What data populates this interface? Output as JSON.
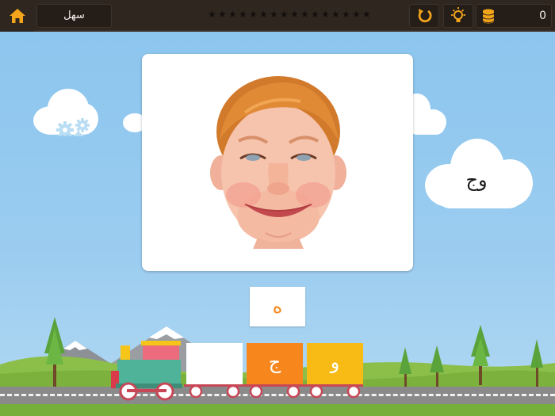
{
  "topbar": {
    "level_label": "سهل",
    "star_count": 16,
    "coins": "0",
    "icons": {
      "home": "home-icon",
      "reset": "reset-icon",
      "hint": "lightbulb-icon",
      "coins": "coin-stack-icon"
    },
    "colors": {
      "bar": "#2f2620",
      "accent": "#f2a51b"
    }
  },
  "clouds": {
    "word": "وج"
  },
  "answer": {
    "letter": "ه"
  },
  "train": {
    "wagons": [
      {
        "letter": "",
        "color": "#ffffff"
      },
      {
        "letter": "ج",
        "color": "#f7871d"
      },
      {
        "letter": "و",
        "color": "#f8bb16"
      }
    ]
  }
}
